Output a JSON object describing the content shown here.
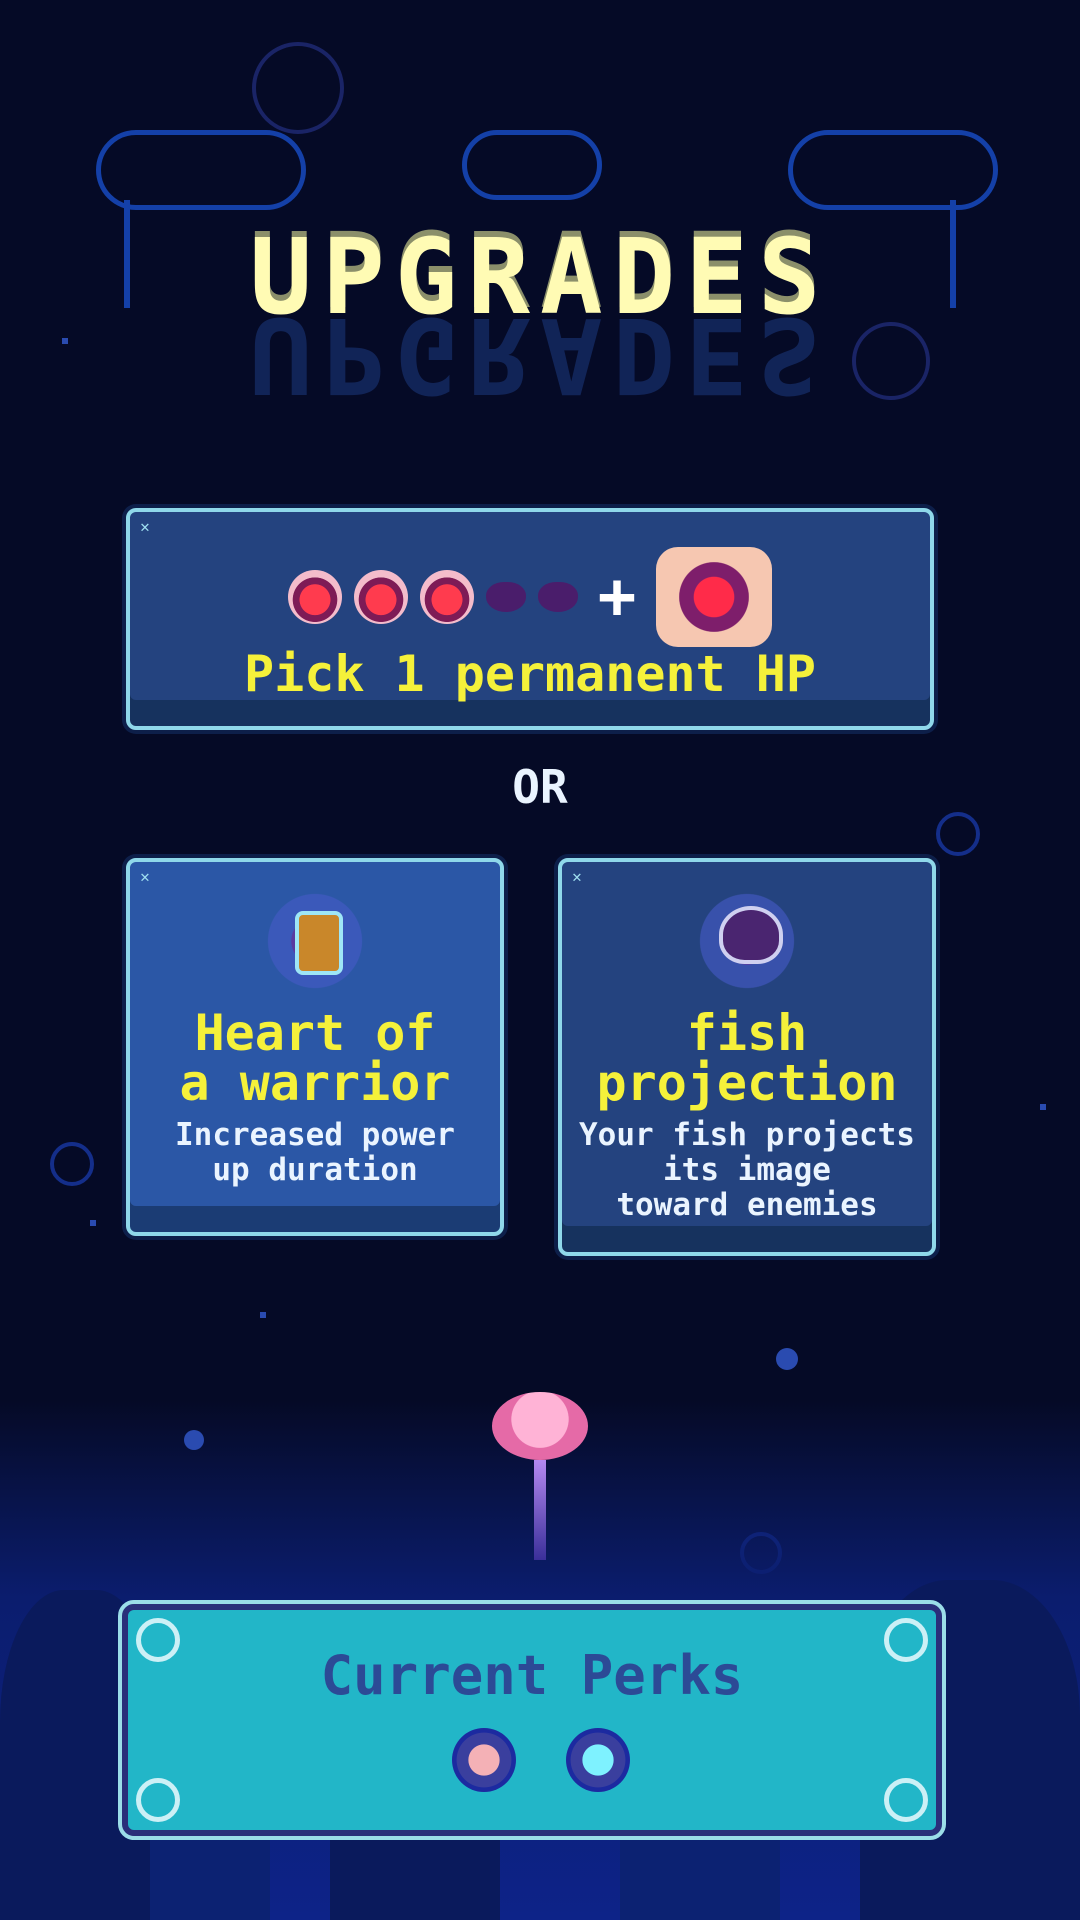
{
  "screen": {
    "title": "UPGRADES",
    "title_reflection": "UPGRADES"
  },
  "hp_option": {
    "label": "Pick 1 permanent HP",
    "filled_hearts": 3,
    "empty_hearts": 2,
    "plus_symbol": "+"
  },
  "separator": "OR",
  "perk_options": [
    {
      "title_line1": "Heart of",
      "title_line2": "a warrior",
      "desc_line1": "Increased power",
      "desc_line2": "up duration",
      "icon": "warrior-bottle-icon"
    },
    {
      "title_line1": "fish",
      "title_line2": "projection",
      "desc_line1": "Your fish projects",
      "desc_line2": "its image",
      "desc_line3": "toward enemies",
      "icon": "fish-projection-icon"
    }
  ],
  "current_perks": {
    "title": "Current Perks",
    "icons": [
      "pink-orb-perk-icon",
      "cyan-crystal-perk-icon"
    ]
  },
  "colors": {
    "background": "#050a26",
    "title": "#fffbb4",
    "perk_text": "#f5f13a",
    "card": "#24437f",
    "card_border": "#8fd8ea",
    "panel": "#22b6c8"
  }
}
